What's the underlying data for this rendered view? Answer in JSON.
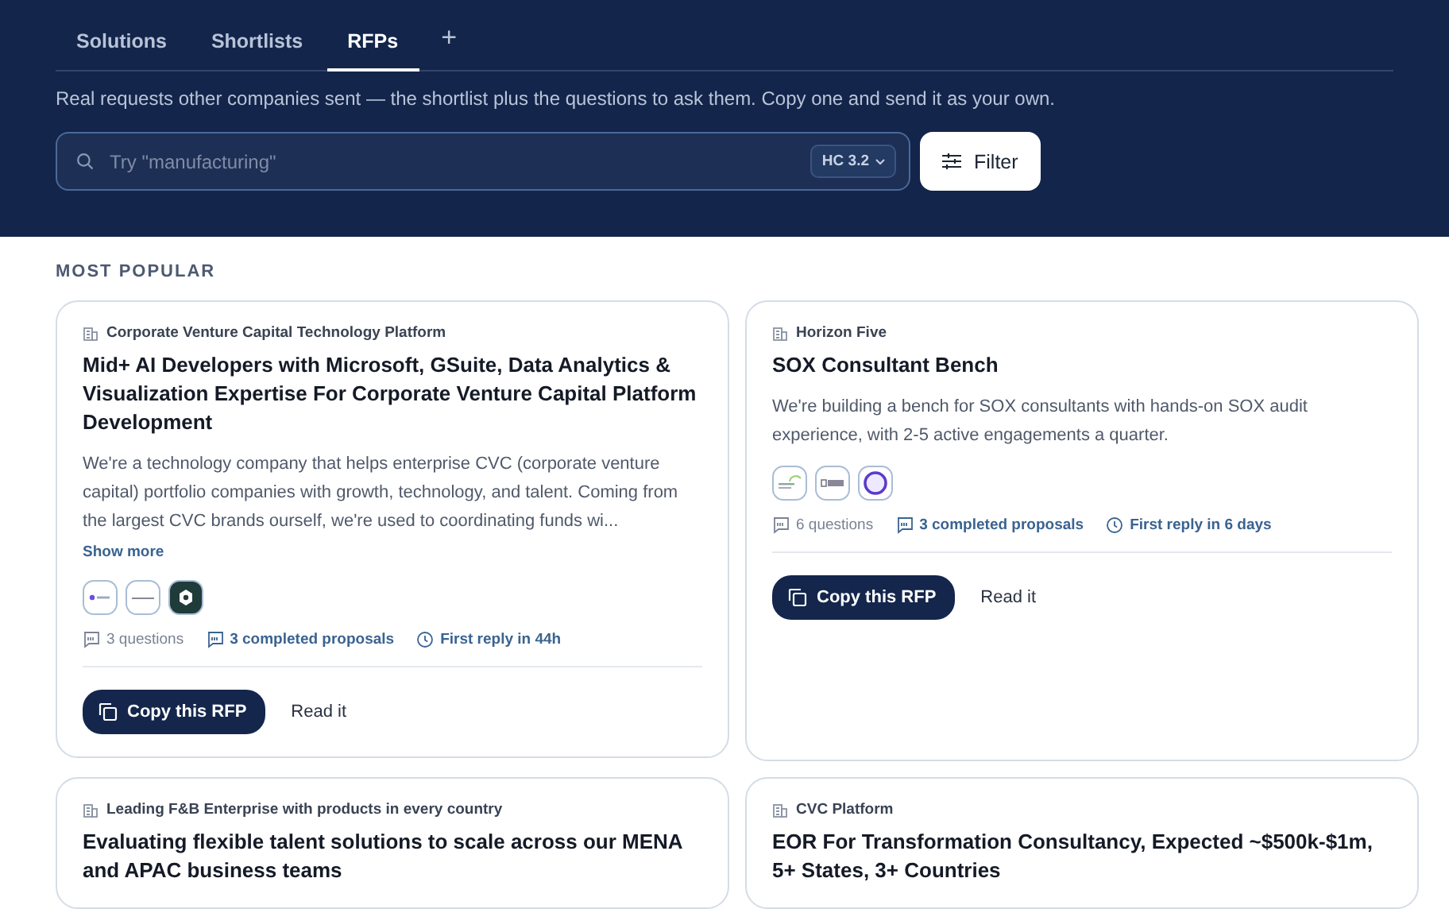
{
  "tabs": [
    {
      "label": "Solutions",
      "selected": false
    },
    {
      "label": "Shortlists",
      "selected": false
    },
    {
      "label": "RFPs",
      "selected": true
    }
  ],
  "add_tab": "+",
  "intro": "Real requests other companies sent — the shortlist plus the questions to ask them. Copy one and send it as your own.",
  "search": {
    "placeholder": "Try \"manufacturing\"",
    "version": "HC 3.2"
  },
  "filter_button": "Filter",
  "section_title": "MOST POPULAR",
  "cards": [
    {
      "company": "Corporate Venture Capital Technology Platform",
      "title": "Mid+ AI Developers with Microsoft, GSuite, Data Analytics & Visualization Expertise For Corporate Venture Capital Platform Development",
      "description": "We're a technology company that helps enterprise CVC (corporate venture capital) portfolio companies with growth, technology, and talent. Coming from the largest CVC brands ourself, we're used to coordinating funds wi...",
      "show_more": "Show more",
      "logos": [
        {
          "kind": "dot"
        },
        {
          "kind": "line"
        },
        {
          "kind": "dark"
        }
      ],
      "questions": "3 questions",
      "proposals": "3 completed proposals",
      "first_reply": "First reply in 44h",
      "copy_button": "Copy this RFP",
      "read_link": "Read it"
    },
    {
      "company": "Horizon Five",
      "title": "SOX Consultant Bench",
      "description": "We're building a bench for SOX consultants with hands-on SOX audit experience, with 2-5 active engagements a quarter.",
      "logos": [
        {
          "kind": "leaf"
        },
        {
          "kind": "text"
        },
        {
          "kind": "ring"
        }
      ],
      "questions": "6 questions",
      "proposals": "3 completed proposals",
      "first_reply": "First reply in 6 days",
      "copy_button": "Copy this RFP",
      "read_link": "Read it"
    },
    {
      "company": "Leading F&B Enterprise with products in every country",
      "title": "Evaluating flexible talent solutions to scale across our MENA and APAC business teams"
    },
    {
      "company": "CVC Platform",
      "title": "EOR For Transformation Consultancy, Expected ~$500k-$1m, 5+ States, 3+ Countries"
    }
  ]
}
